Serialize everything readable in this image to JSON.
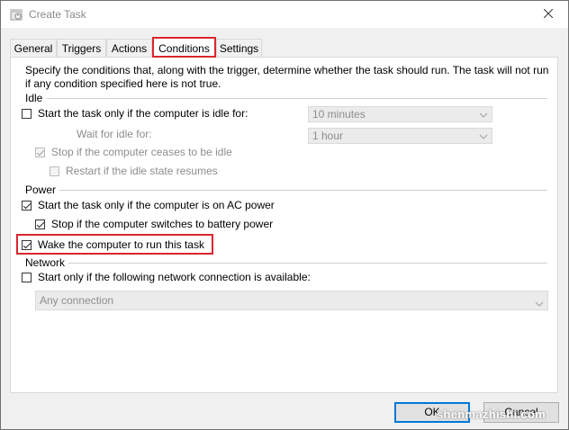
{
  "window": {
    "title": "Create Task"
  },
  "tabs": [
    {
      "label": "General"
    },
    {
      "label": "Triggers"
    },
    {
      "label": "Actions"
    },
    {
      "label": "Conditions"
    },
    {
      "label": "Settings"
    }
  ],
  "description": "Specify the conditions that, along with the trigger, determine whether the task should run.  The task will not run  if any condition specified here is not true.",
  "idle": {
    "group_label": "Idle",
    "start_if_idle": {
      "label": "Start the task only if the computer is idle for:",
      "checked": false
    },
    "idle_for_combo": {
      "value": "10 minutes"
    },
    "wait_label": "Wait for idle for:",
    "wait_combo": {
      "value": "1 hour"
    },
    "stop_if_ceases": {
      "label": "Stop if the computer ceases to be idle",
      "checked": true
    },
    "restart_if_resumes": {
      "label": "Restart if the idle state resumes",
      "checked": false
    }
  },
  "power": {
    "group_label": "Power",
    "start_on_ac": {
      "label": "Start the task only if the computer is on AC power",
      "checked": true
    },
    "stop_on_battery": {
      "label": "Stop if the computer switches to battery power",
      "checked": true
    },
    "wake_to_run": {
      "label": "Wake the computer to run this task",
      "checked": true
    }
  },
  "network": {
    "group_label": "Network",
    "start_if_network": {
      "label": "Start only if the following network connection is available:",
      "checked": false
    },
    "connection_combo": {
      "value": "Any connection"
    }
  },
  "buttons": {
    "ok": "OK",
    "cancel": "Cancel"
  },
  "watermark": "shenmazhishi.com",
  "colors": {
    "highlight": "#d9262e",
    "accent": "#0078d7"
  }
}
